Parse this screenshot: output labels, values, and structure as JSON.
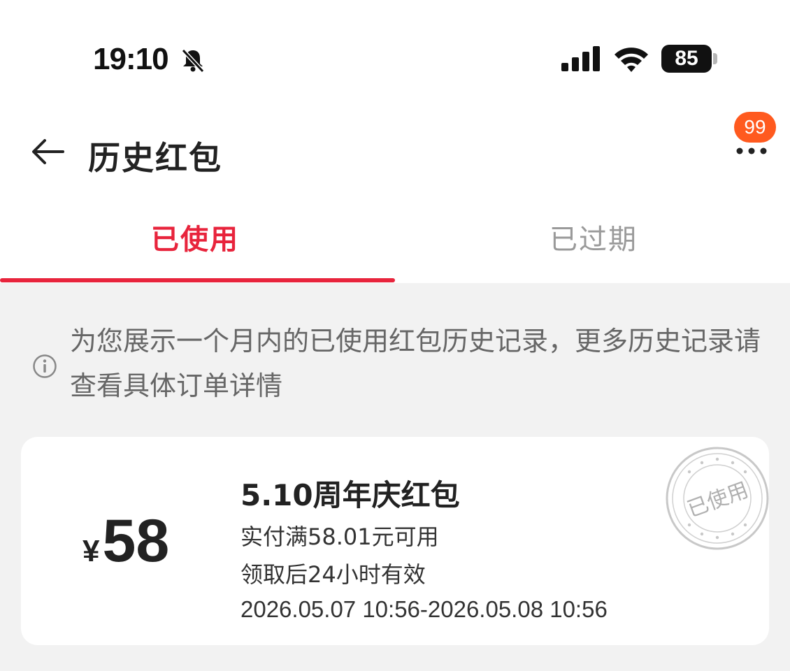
{
  "status_bar": {
    "time": "19:10",
    "battery": "85",
    "icons": [
      "bell-muted-icon",
      "signal-icon",
      "wifi-icon",
      "battery-icon"
    ]
  },
  "nav": {
    "title": "历史红包",
    "badge": "99",
    "icons": [
      "back-arrow-icon",
      "more-icon"
    ]
  },
  "tabs": [
    {
      "label": "已使用",
      "active": true
    },
    {
      "label": "已过期",
      "active": false
    }
  ],
  "notice": {
    "text": "为您展示一个月内的已使用红包历史记录，更多历史记录请查看具体订单详情",
    "icon": "info-icon"
  },
  "card": {
    "currency": "¥",
    "amount": "58",
    "title": "5.10周年庆红包",
    "condition": "实付满58.01元可用",
    "validity": "领取后24小时有效",
    "period": "2026.05.07 10:56-2026.05.08 10:56",
    "stamp": "已使用"
  },
  "colors": {
    "accent": "#e8243c",
    "badge": "#ff5a1f",
    "background": "#f2f2f2"
  }
}
